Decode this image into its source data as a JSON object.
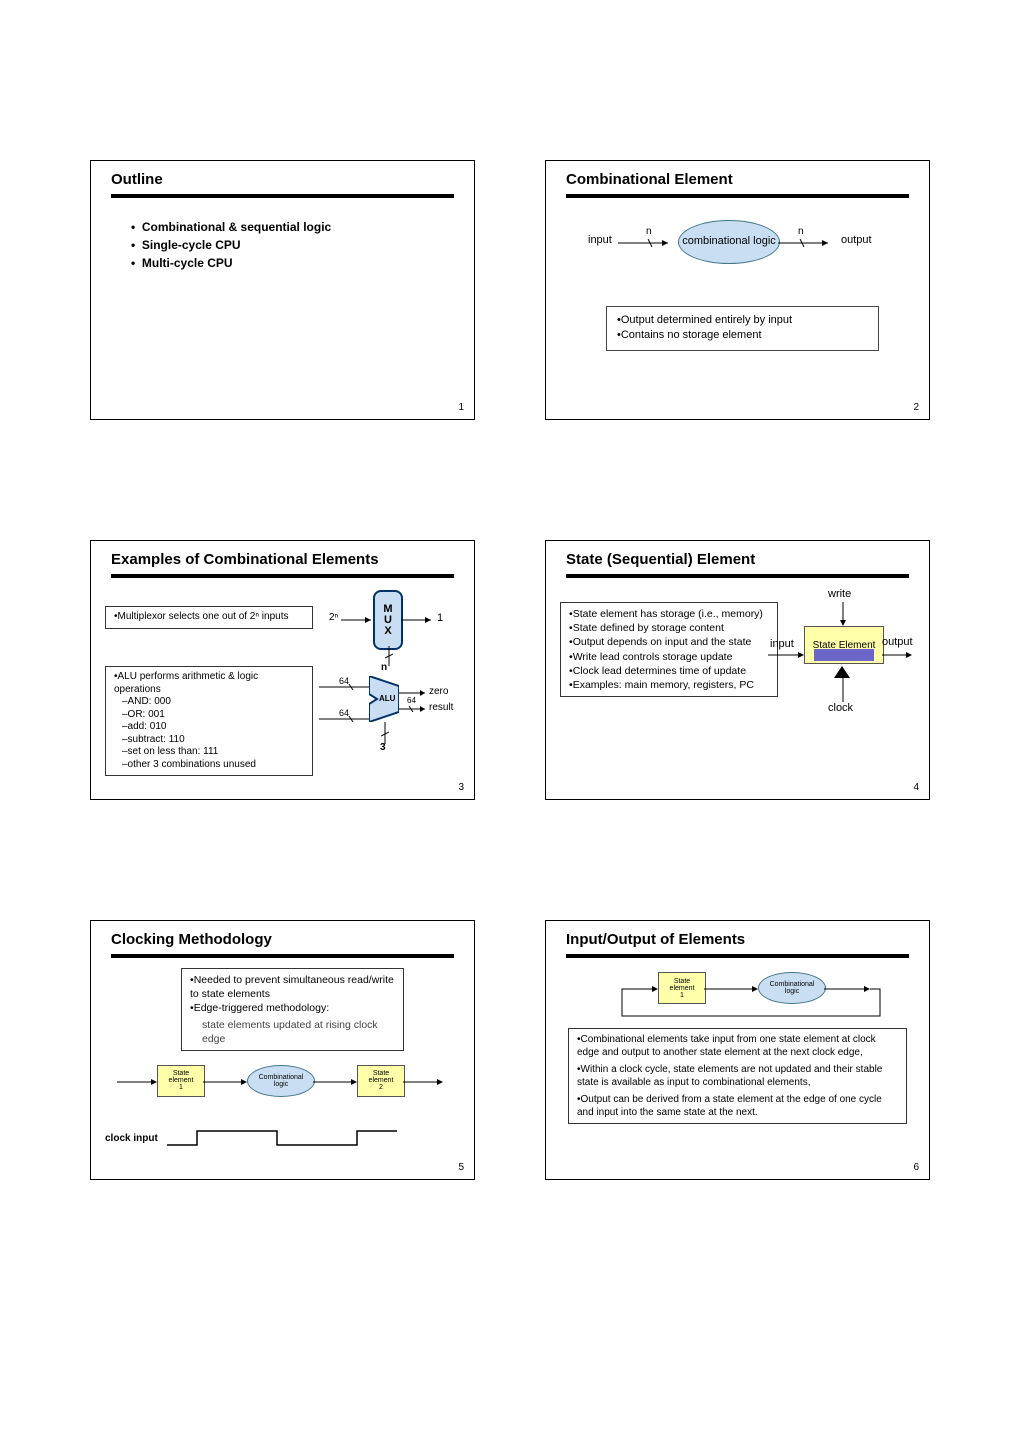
{
  "slides": {
    "s1": {
      "title": "Outline",
      "items": [
        "Combinational & sequential logic",
        "Single-cycle CPU",
        "Multi-cycle CPU"
      ],
      "page": "1"
    },
    "s2": {
      "title": "Combinational Element",
      "input_label": "input",
      "output_label": "output",
      "bubble": "combinational logic",
      "n_left": "n",
      "n_right": "n",
      "notes": [
        "Output determined entirely by input",
        "Contains no storage element"
      ],
      "page": "2"
    },
    "s3": {
      "title": "Examples of Combinational Elements",
      "box1": "Multiplexor selects one out of 2ⁿ inputs",
      "box2_title": "ALU performs arithmetic & logic operations",
      "box2_lines": [
        "–AND: 000",
        "–OR: 001",
        "–add: 010",
        "–subtract: 110",
        "–set on less than: 111",
        "–other 3 combinations unused"
      ],
      "mux_in": "2ⁿ",
      "mux_label": "M\nU\nX",
      "mux_out": "1",
      "mux_n": "n",
      "alu_in_top": "64",
      "alu_in_bot": "64",
      "alu_label": "ALU",
      "alu_zero": "zero",
      "alu_result": "result",
      "alu_result_n": "64",
      "alu_ctl": "3",
      "page": "3"
    },
    "s4": {
      "title": "State (Sequential) Element",
      "list": [
        "State element has storage (i.e., memory)",
        "State defined by storage content",
        "Output depends on input and the state",
        "Write lead controls storage update",
        "Clock lead determines time of update",
        "Examples: main memory, registers, PC"
      ],
      "write": "write",
      "state_label": "State Element",
      "input": "input",
      "output": "output",
      "clock": "clock",
      "page": "4"
    },
    "s5": {
      "title": "Clocking Methodology",
      "notes": [
        "Needed to prevent simultaneous read/write to state elements",
        "Edge-triggered methodology:"
      ],
      "sub": "state elements updated at rising clock edge",
      "se1": "State\nelement\n1",
      "cl": "Combinational\nlogic",
      "se2": "State\nelement\n2",
      "clock_input": "clock input",
      "page": "5"
    },
    "s6": {
      "title": "Input/Output of Elements",
      "se1": "State\nelement\n1",
      "cl": "Combinational\nlogic",
      "notes": [
        "Combinational elements take input from one state element at clock edge and output to another state element at the next clock edge,",
        "Within a clock cycle, state elements are not updated and their stable state is available as input to combinational elements,",
        "Output can be derived from a state element at the edge of one cycle and input into the same state at the next."
      ],
      "page": "6"
    }
  }
}
